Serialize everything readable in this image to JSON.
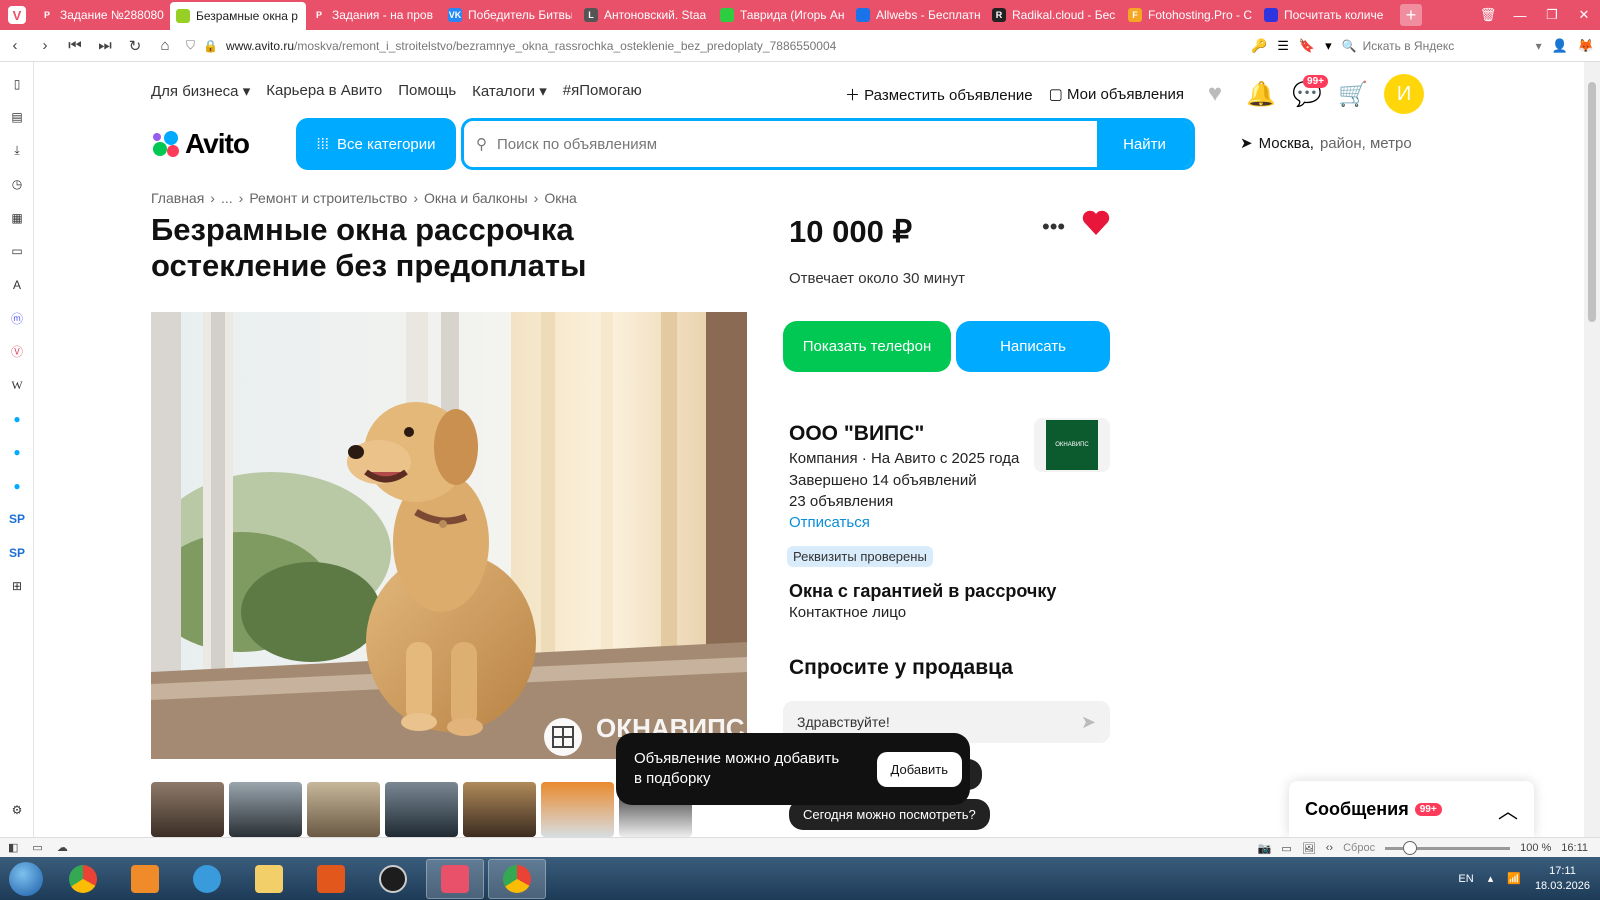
{
  "browser": {
    "tabs": [
      {
        "label": "Задание №288080",
        "fav_color": "#e9506a",
        "fav_glyph": "P",
        "active": false
      },
      {
        "label": "Безрамные окна р",
        "fav_color": "#97cf26",
        "fav_glyph": "",
        "active": true
      },
      {
        "label": "Задания - на пров",
        "fav_color": "#e9506a",
        "fav_glyph": "P",
        "active": false
      },
      {
        "label": "Победитель Битвы",
        "fav_color": "#2787f5",
        "fav_glyph": "VK",
        "active": false
      },
      {
        "label": "Антоновский. Staa",
        "fav_color": "#555555",
        "fav_glyph": "L",
        "active": false
      },
      {
        "label": "Таврида (Игорь Ан",
        "fav_color": "#2ecc40",
        "fav_glyph": "",
        "active": false
      },
      {
        "label": "Allwebs - Бесплатн",
        "fav_color": "#1a73e8",
        "fav_glyph": "",
        "active": false
      },
      {
        "label": "Radikal.cloud - Бес",
        "fav_color": "#222222",
        "fav_glyph": "R",
        "active": false
      },
      {
        "label": "Fotohosting.Pro - С",
        "fav_color": "#f5a623",
        "fav_glyph": "F",
        "active": false
      },
      {
        "label": "Посчитать количе",
        "fav_color": "#2d34e0",
        "fav_glyph": "",
        "active": false
      }
    ],
    "url_host": "www.avito.ru",
    "url_path": "/moskva/remont_i_stroitelstvo/bezramnye_okna_rassrochka_osteklenie_bez_predoplaty_7886550004",
    "yandex_placeholder": "Искать в Яндекс",
    "status": {
      "reset_label": "Сброс",
      "zoom": "100 %",
      "time": "16:11"
    }
  },
  "site": {
    "topnav": [
      "Для бизнеса",
      "Карьера в Авито",
      "Помощь",
      "Каталоги",
      "#яПомогаю"
    ],
    "post_ad": "Разместить объявление",
    "my_ads": "Мои объявления",
    "messages_badge": "99+",
    "avatar_letter": "И",
    "logo_text": "Avito",
    "all_categories": "Все категории",
    "search_placeholder": "Поиск по объявлениям",
    "search_button": "Найти",
    "location_city": "Москва,",
    "location_rest": "район, метро"
  },
  "listing": {
    "breadcrumb": [
      "Главная",
      "...",
      "Ремонт и строительство",
      "Окна и балконы",
      "Окна"
    ],
    "title": "Безрамные окна рассрочка остекление без предоплаты",
    "price": "10 000 ₽",
    "reply_time": "Отвечает около 30 минут",
    "show_phone": "Показать телефон",
    "write": "Написать",
    "watermark": "ОКНАВИПС",
    "thumb_count": 7
  },
  "seller": {
    "name": "ООО \"ВИПС\"",
    "type_line": "Компания · На Авито с 2025 года",
    "completed": "Завершено 14 объявлений",
    "ads_count": "23 объявления",
    "unsubscribe": "Отписаться",
    "verified": "Реквизиты проверены",
    "logo_text": "ОКНАВИПС",
    "offer_title": "Окна с гарантией в рассрочку",
    "contact": "Контактное лицо"
  },
  "ask": {
    "title": "Спросите у продавца",
    "input_value": "Здравствуйте!",
    "chip1": "ть?",
    "chip2": "Сегодня можно посмотреть?"
  },
  "toast": {
    "text": "Объявление можно добавить в подборку",
    "button": "Добавить"
  },
  "messages_panel": {
    "title": "Сообщения",
    "badge": "99+"
  },
  "taskbar": {
    "lang": "EN",
    "time": "17:11",
    "date": "18.03.2026"
  },
  "colors": {
    "avito_blue": "#00aaff",
    "avito_green": "#00c853",
    "vivaldi_red": "#e9506a"
  }
}
